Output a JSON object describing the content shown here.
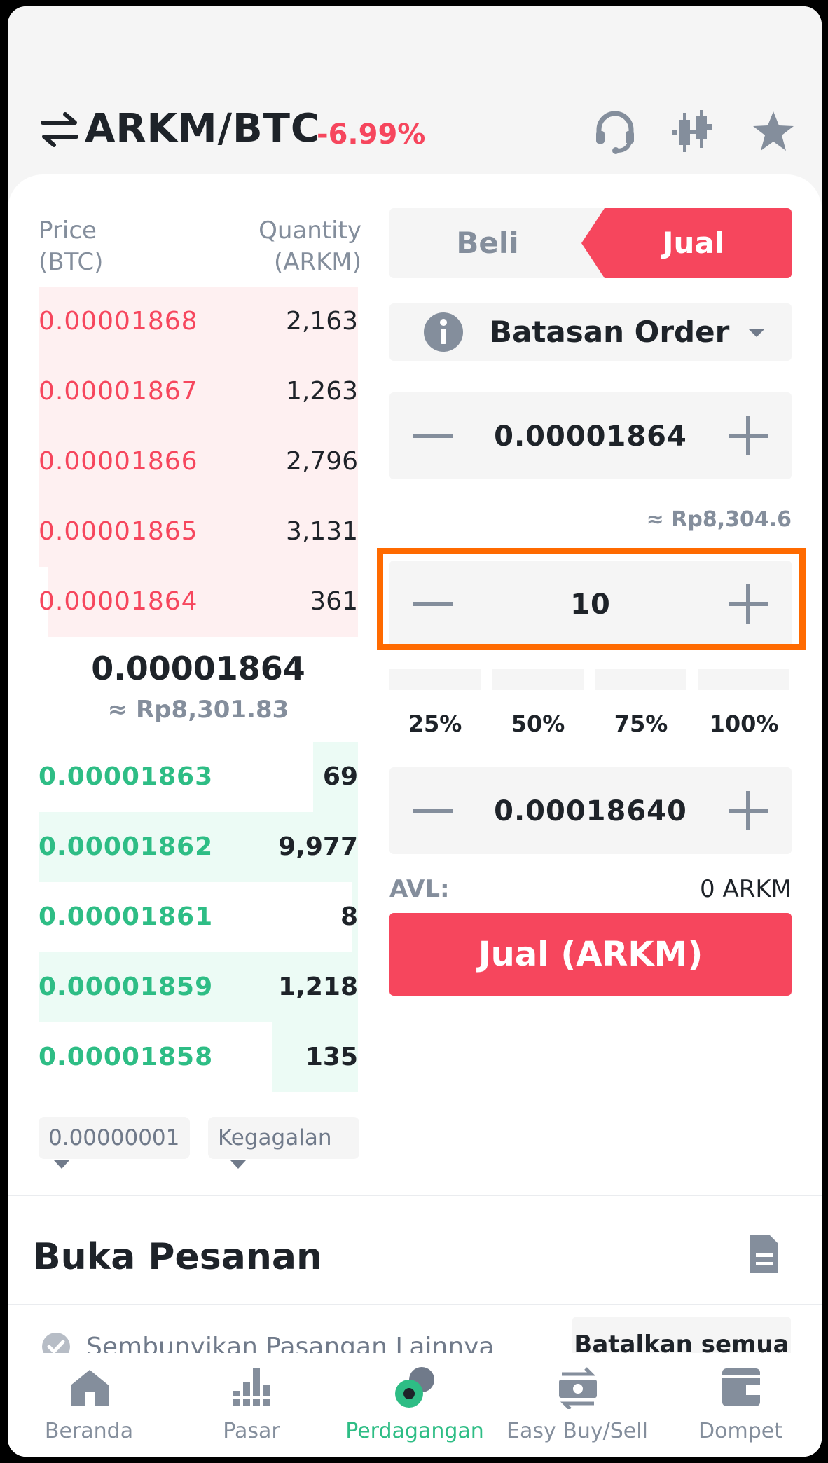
{
  "header": {
    "pair": "ARKM/BTC",
    "change": "-6.99%"
  },
  "orderbook": {
    "price_header_1": "Price",
    "price_header_2": "(BTC)",
    "qty_header_1": "Quantity",
    "qty_header_2": "(ARKM)",
    "asks": [
      {
        "price": "0.00001868",
        "qty": "2,163",
        "depth": 1.0
      },
      {
        "price": "0.00001867",
        "qty": "1,263",
        "depth": 1.0
      },
      {
        "price": "0.00001866",
        "qty": "2,796",
        "depth": 1.0
      },
      {
        "price": "0.00001865",
        "qty": "3,131",
        "depth": 1.0
      },
      {
        "price": "0.00001864",
        "qty": "361",
        "depth": 0.97
      }
    ],
    "mid_price": "0.00001864",
    "mid_approx": "≈ Rp8,301.83",
    "bids": [
      {
        "price": "0.00001863",
        "qty": "69",
        "depth": 0.14
      },
      {
        "price": "0.00001862",
        "qty": "9,977",
        "depth": 1.0
      },
      {
        "price": "0.00001861",
        "qty": "8",
        "depth": 0.02
      },
      {
        "price": "0.00001859",
        "qty": "1,218",
        "depth": 1.0
      },
      {
        "price": "0.00001858",
        "qty": "135",
        "depth": 0.27
      }
    ],
    "precision": "0.00000001",
    "mode": "Kegagalan"
  },
  "trade": {
    "tab_buy": "Beli",
    "tab_sell": "Jual",
    "order_type": "Batasan Order",
    "price_value": "0.00001864",
    "price_approx": "≈ Rp8,304.6",
    "amount_value": "10",
    "pct": [
      "25%",
      "50%",
      "75%",
      "100%"
    ],
    "total_value": "0.00018640",
    "avl_label": "AVL:",
    "avl_value": "0 ARKM",
    "sell_button": "Jual (ARKM)"
  },
  "open_orders": {
    "title": "Buka Pesanan",
    "hide_other_pairs": "Sembunyikan Pasangan Lainnya",
    "cancel_all": "Batalkan semua"
  },
  "nav": [
    {
      "label": "Beranda",
      "icon": "home-icon"
    },
    {
      "label": "Pasar",
      "icon": "market-icon"
    },
    {
      "label": "Perdagangan",
      "icon": "trade-icon"
    },
    {
      "label": "Easy Buy/Sell",
      "icon": "easy-buy-sell-icon"
    },
    {
      "label": "Dompet",
      "icon": "wallet-icon"
    }
  ],
  "colors": {
    "sell_red": "#f6465d",
    "buy_green": "#2ebd85",
    "highlight_orange": "#ff6a00"
  }
}
